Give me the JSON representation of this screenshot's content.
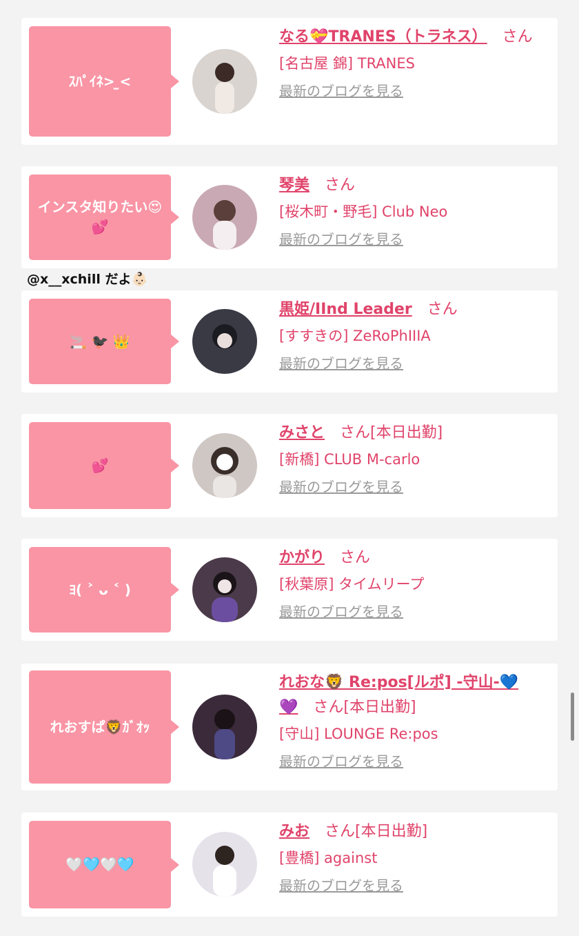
{
  "overlay_text": "@x__xchill だよ👶🏻",
  "common": {
    "san": "さん",
    "blog_link": "最新のブログを見る"
  },
  "cards": [
    {
      "bubble": "ｽﾊﾟｲﾈ> ̫<",
      "name": "なる💝TRANES（トラネス）",
      "status": "",
      "shop": "[名古屋 錦] TRANES",
      "avatar_color": "#d9d4d0"
    },
    {
      "bubble": "インスタ知りたい😍💕",
      "name": "琴美",
      "status": "",
      "shop": "[桜木町・野毛] Club Neo",
      "avatar_color": "#c9a9b4"
    },
    {
      "bubble": "🚬 🐦‍⬛ 👑",
      "name": "黒姫/IInd Leader",
      "status": "",
      "shop": "[すすきの] ZeRoPhIIIA",
      "avatar_color": "#3a3a45"
    },
    {
      "bubble": "💕",
      "name": "みさと",
      "status": "[本日出勤]",
      "shop": "[新橋] CLUB M-carlo",
      "avatar_color": "#cfc7c3"
    },
    {
      "bubble": "ﾖ( ˃ ᴗ ˂ )",
      "name": "かがり",
      "status": "",
      "shop": "[秋葉原] タイムリープ",
      "avatar_color": "#4b3a4a"
    },
    {
      "bubble": "れおすぱ🦁ｶﾞｵｯ",
      "name": "れおな🦁 Re:pos[ルポ] -守山-💙💜",
      "status": "[本日出勤]",
      "shop": "[守山] LOUNGE Re:pos",
      "avatar_color": "#3a2a3a"
    },
    {
      "bubble": "🤍🩵🤍🩵",
      "name": "みお",
      "status": "[本日出勤]",
      "shop": "[豊橋] against",
      "avatar_color": "#e6e2ea"
    }
  ]
}
